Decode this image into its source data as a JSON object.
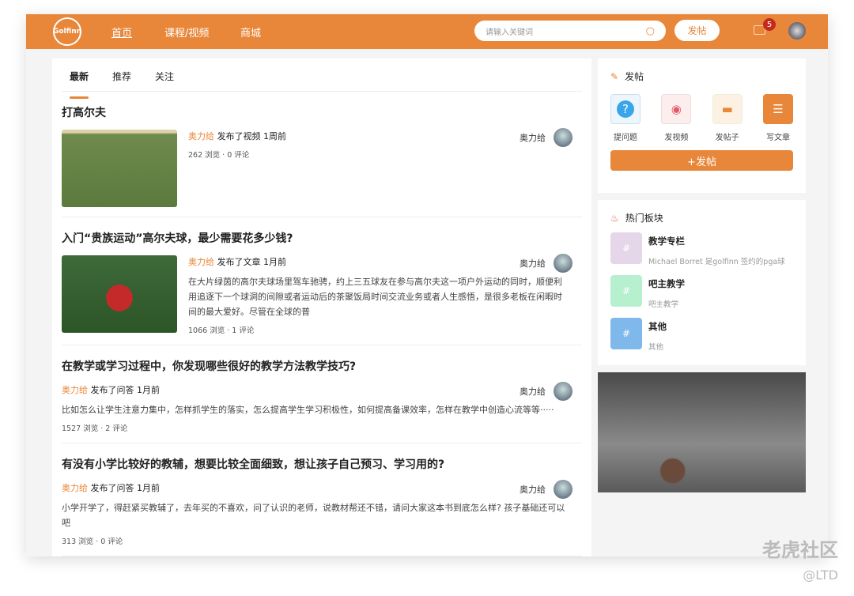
{
  "header": {
    "logo": "Golfinn",
    "nav": [
      "首页",
      "课程/视频",
      "商城"
    ],
    "search_placeholder": "请输入关键词",
    "post_button": "发帖",
    "notifications": "5"
  },
  "tabs": [
    "最新",
    "推荐",
    "关注"
  ],
  "posts": [
    {
      "title": "打高尔夫",
      "author": "奥力给",
      "action": "发布了视频 1周前",
      "excerpt": "",
      "stats": "262 浏览 · 0 评论",
      "right_author": "奥力给"
    },
    {
      "title": "入门“贵族运动”高尔夫球，最少需要花多少钱?",
      "author": "奥力给",
      "action": "发布了文章 1月前",
      "excerpt": "在大片绿茵的高尔夫球场里驾车驰骋，约上三五球友在参与高尔夫这一项户外运动的同时，顺便利用追逐下一个球洞的间隙或者运动后的茶聚饭局时间交流业务或者人生感悟，是很多老板在闲暇时间的最大爱好。尽管在全球的普",
      "stats": "1066 浏览 · 1 评论",
      "right_author": "奥力给"
    },
    {
      "title": "在教学或学习过程中，你发现哪些很好的教学方法教学技巧?",
      "author": "奥力给",
      "action": "发布了问答 1月前",
      "excerpt": "比如怎么让学生注意力集中，怎样抓学生的落实，怎么提高学生学习积极性，如何提高备课效率，怎样在教学中创造心流等等·····",
      "stats": "1527 浏览 · 2 评论",
      "right_author": "奥力给"
    },
    {
      "title": "有没有小学比较好的教辅，想要比较全面细致，想让孩子自己预习、学习用的?",
      "author": "奥力给",
      "action": "发布了问答 1月前",
      "excerpt": "小学开学了，得赶紧买教辅了，去年买的不喜欢，问了认识的老师，说教材帮还不错，请问大家这本书到底怎么样? 孩子基础还可以吧",
      "stats": "313 浏览 · 0 评论",
      "right_author": "奥力给"
    }
  ],
  "post_panel": {
    "title": "发帖",
    "actions": [
      "提问题",
      "发视频",
      "发帖子",
      "写文章"
    ],
    "button": "+发帖"
  },
  "hot": {
    "title": "热门板块",
    "items": [
      {
        "name": "教学专栏",
        "desc": "Michael Borret 是golfinn 签约的pga球",
        "color": "#e6d6ea"
      },
      {
        "name": "吧主教学",
        "desc": "吧主教学",
        "color": "#b6f0cf"
      },
      {
        "name": "其他",
        "desc": "其他",
        "color": "#7fb8ea"
      }
    ]
  },
  "watermark": {
    "text": "老虎社区",
    "sub": "@LTD"
  }
}
